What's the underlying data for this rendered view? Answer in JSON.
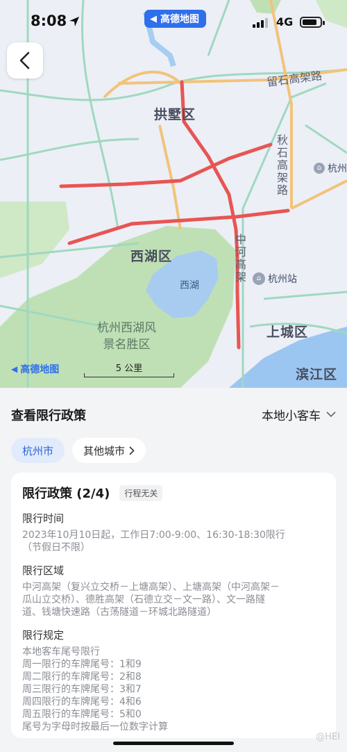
{
  "status_bar": {
    "time": "8:08",
    "network": "4G"
  },
  "map": {
    "brand": "高德地图",
    "scale_label": "5 公里",
    "districts": [
      "拱墅区",
      "西湖区",
      "上城区",
      "滨江区"
    ],
    "roads": [
      "留石高架路",
      "秋石高架路",
      "中河高架"
    ],
    "lake": "西湖",
    "scenic_area": [
      "杭州西湖风",
      "景名胜区"
    ],
    "pois": [
      "杭州",
      "杭州站"
    ]
  },
  "panel": {
    "title": "查看限行政策",
    "vehicle_type": "本地小客车",
    "city_chip": "杭州市",
    "other_cities": "其他城市"
  },
  "policy": {
    "title": "限行政策 (2/4)",
    "tag": "行程无关",
    "time_heading": "限行时间",
    "time_lines": [
      "2023年10月10日起，工作日7:00-9:00、16:30-18:30限行",
      "（节假日不限）"
    ],
    "area_heading": "限行区域",
    "area_lines": [
      "中河高架（复兴立交桥－上塘高架）、上塘高架（中河高架－",
      "瓜山立交桥）、德胜高架（石德立交－文一路）、文一路隧",
      "道、钱塘快速路（古荡隧道－环城北路隧道）"
    ],
    "rule_heading": "限行规定",
    "rule_lines": [
      "本地客车尾号限行",
      "周一限行的车牌尾号：1和9",
      "周二限行的车牌尾号：2和8",
      "周三限行的车牌尾号：3和7",
      "周四限行的车牌尾号：4和6",
      "周五限行的车牌尾号：5和0",
      "尾号为字母时按最后一位数字计算"
    ]
  },
  "watermark": "@HEI"
}
